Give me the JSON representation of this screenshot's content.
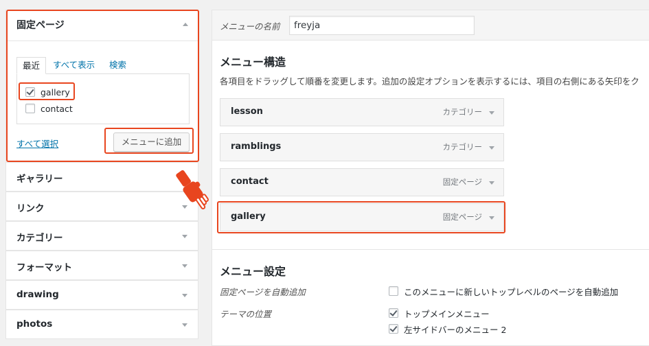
{
  "left_panel": {
    "open_section": {
      "title": "固定ページ",
      "tabs": [
        {
          "label": "最近",
          "active": true
        },
        {
          "label": "すべて表示",
          "active": false
        },
        {
          "label": "検索",
          "active": false
        }
      ],
      "pages": [
        {
          "label": "gallery",
          "checked": true
        },
        {
          "label": "contact",
          "checked": false
        }
      ],
      "select_all": "すべて選択",
      "add_button": "メニューに追加"
    },
    "sections": [
      {
        "label": "ギャラリー"
      },
      {
        "label": "リンク"
      },
      {
        "label": "カテゴリー"
      },
      {
        "label": "フォーマット"
      },
      {
        "label": "drawing"
      },
      {
        "label": "photos"
      }
    ]
  },
  "menu_name": {
    "label": "メニューの名前",
    "value": "freyja"
  },
  "structure": {
    "title": "メニュー構造",
    "description": "各項目をドラッグして順番を変更します。追加の設定オプションを表示するには、項目の右側にある矢印をク",
    "items": [
      {
        "title": "lesson",
        "type": "カテゴリー"
      },
      {
        "title": "ramblings",
        "type": "カテゴリー"
      },
      {
        "title": "contact",
        "type": "固定ページ"
      },
      {
        "title": "gallery",
        "type": "固定ページ"
      }
    ]
  },
  "settings": {
    "title": "メニュー設定",
    "auto_add_label": "固定ページを自動追加",
    "auto_add_option": {
      "label": "このメニューに新しいトップレベルのページを自動追加",
      "checked": false
    },
    "theme_location_label": "テーマの位置",
    "locations": [
      {
        "label": "トップメインメニュー",
        "checked": true
      },
      {
        "label": "左サイドバーのメニュー 2",
        "checked": true
      }
    ]
  },
  "colors": {
    "highlight": "#e8451e",
    "link": "#0073aa"
  },
  "icons": {
    "collapse": "triangle-up-icon",
    "expand": "triangle-down-icon",
    "pointer": "pointing-hand-icon"
  }
}
